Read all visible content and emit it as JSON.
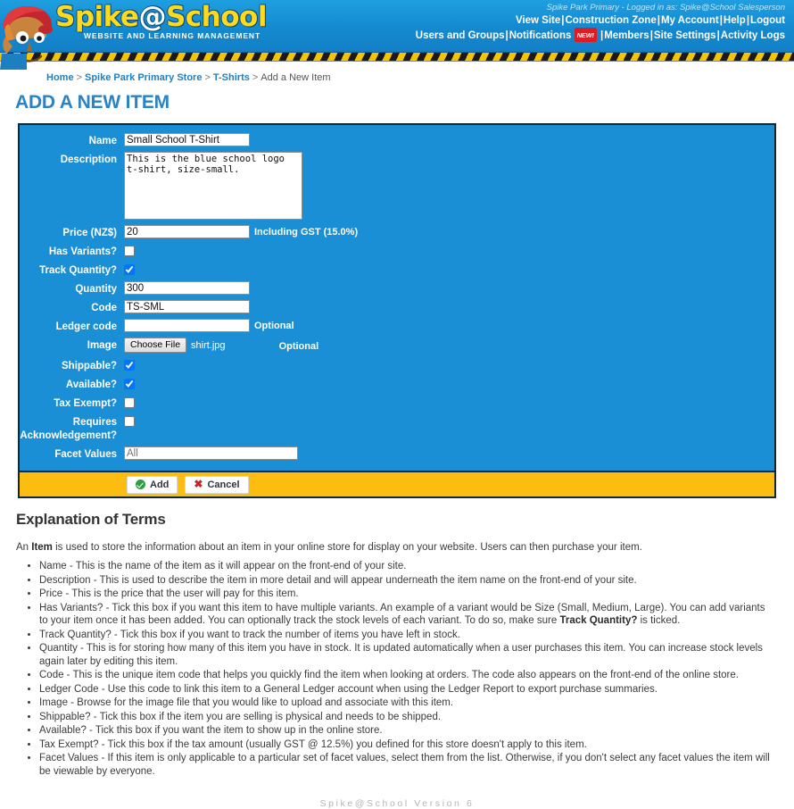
{
  "header": {
    "logo_title_left": "Spike",
    "logo_title_at": "@",
    "logo_title_right": "School",
    "logo_subtitle": "WEBSITE AND LEARNING MANAGEMENT",
    "user_line": "Spike Park Primary - Logged in as: Spike@School Salesperson",
    "nav_row1": [
      {
        "label": "View Site"
      },
      {
        "label": "Construction Zone"
      },
      {
        "label": "My Account"
      },
      {
        "label": "Help"
      },
      {
        "label": "Logout"
      }
    ],
    "nav_row2": [
      {
        "label": "Users and Groups"
      },
      {
        "label": "Notifications",
        "badge": "NEW!"
      },
      {
        "label": "Members"
      },
      {
        "label": "Site Settings"
      },
      {
        "label": "Activity Logs"
      }
    ],
    "separator": "|"
  },
  "breadcrumb": {
    "items": [
      {
        "label": "Home",
        "link": true
      },
      {
        "label": "Spike Park Primary Store",
        "link": true
      },
      {
        "label": "T-Shirts",
        "link": true
      },
      {
        "label": "Add a New Item",
        "link": false
      }
    ],
    "separator": ">"
  },
  "page_title": "ADD A NEW ITEM",
  "form": {
    "name": {
      "label": "Name",
      "value": "Small School T-Shirt"
    },
    "description": {
      "label": "Description",
      "value": "This is the blue school logo t-shirt, size-small."
    },
    "price": {
      "label": "Price (NZ$)",
      "value": "20",
      "hint": "Including GST (15.0%)"
    },
    "has_variants": {
      "label": "Has Variants?",
      "checked": false
    },
    "track_quantity": {
      "label": "Track Quantity?",
      "checked": true
    },
    "quantity": {
      "label": "Quantity",
      "value": "300"
    },
    "code": {
      "label": "Code",
      "value": "TS-SML"
    },
    "ledger_code": {
      "label": "Ledger code",
      "value": "",
      "hint": "Optional"
    },
    "image": {
      "label": "Image",
      "button": "Choose File",
      "filename": "shirt.jpg",
      "hint": "Optional"
    },
    "shippable": {
      "label": "Shippable?",
      "checked": true
    },
    "available": {
      "label": "Available?",
      "checked": true
    },
    "tax_exempt": {
      "label": "Tax Exempt?",
      "checked": false
    },
    "requires_ack": {
      "label": "Requires Acknowledgement?",
      "checked": false
    },
    "facet_values": {
      "label": "Facet Values",
      "value": "",
      "placeholder": "All"
    },
    "add_button": "Add",
    "cancel_button": "Cancel"
  },
  "explanation": {
    "heading": "Explanation of Terms",
    "intro_before": "An ",
    "intro_bold": "Item",
    "intro_after": " is used to store the information about an item in your online store for display on your website. Users can then purchase your item.",
    "items": [
      "Name - This is the name of the item as it will appear on the front-end of your site.",
      "Description - This is used to describe the item in more detail and will appear underneath the item name on the front-end of your site.",
      "Price - This is the price that the user will pay for this item.",
      "Track Quantity? - Tick this box if you want to track the number of items you have left in stock.",
      "Quantity - This is for storing how many of this item you have in stock. It is updated automatically when a user purchases this item. You can increase stock levels again later by editing this item.",
      "Code - This is the unique item code that helps you quickly find the item when looking at orders. The code also appears on the front-end of the online store.",
      "Ledger Code - Use this code to link this item to a General Ledger account when using the Ledger Report to export purchase summaries.",
      "Image - Browse for the image file that you would like to upload and associate with this item.",
      "Shippable? - Tick this box if the item you are selling is physical and needs to be shipped.",
      "Available? - Tick this box if you want the item to show up in the online store.",
      "Tax Exempt? - Tick this box if the tax amount (usually GST @ 12.5%) you defined for this store doesn't apply to this item.",
      "Facet Values - If this item is only applicable to a particular set of facet values, select them from the list. Otherwise, if you don't select any facet values the item will be viewable by everyone."
    ],
    "variants_before": "Has Variants? - Tick this box if you want this item to have multiple variants. An example of a variant would be Size (Small, Medium, Large). You can add variants to your item once it has been added. You can optionally track the stock levels of each variant. To do so, make sure ",
    "variants_bold": "Track Quantity?",
    "variants_after": " is ticked."
  },
  "footer": "Spike@School Version 6",
  "colors": {
    "header_blue": "#1489cf",
    "panel_blue": "#1b8fd6",
    "panel_border": "#16262f",
    "footer_amber": "#fcbd10",
    "title_blue": "#2a83c4",
    "badge_red": "#e01b24",
    "hazard_yellow": "#f5c400"
  }
}
